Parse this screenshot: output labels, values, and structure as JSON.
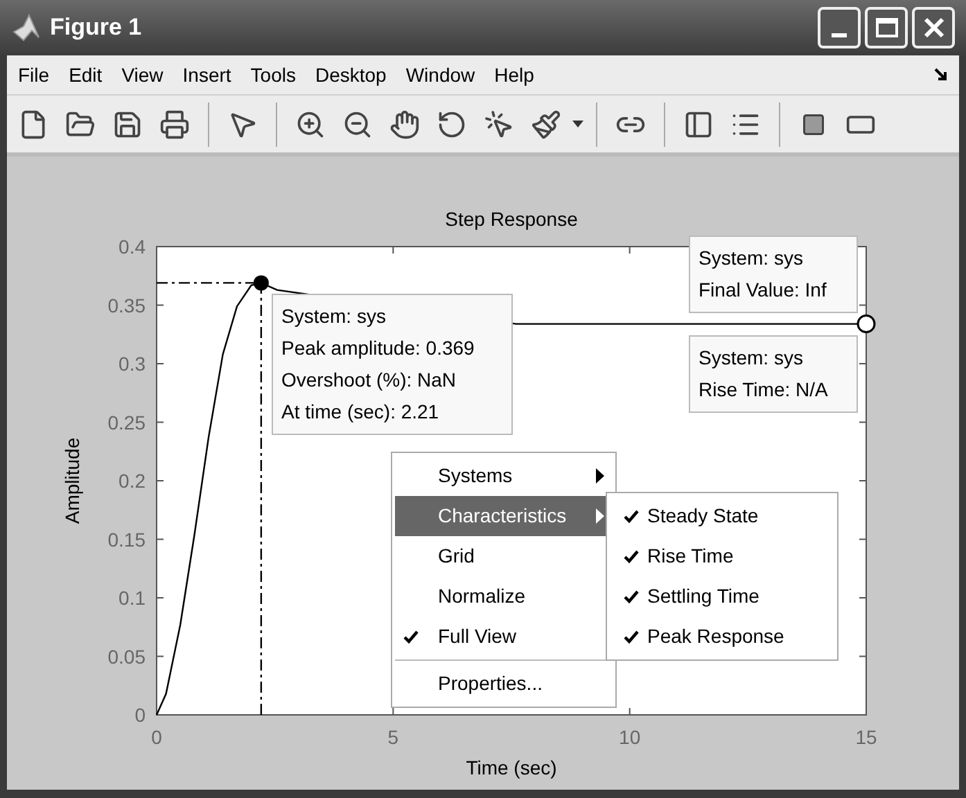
{
  "window": {
    "title": "Figure 1"
  },
  "menu_bar": {
    "items": [
      "File",
      "Edit",
      "View",
      "Insert",
      "Tools",
      "Desktop",
      "Window",
      "Help"
    ]
  },
  "figure": {
    "chart_data": {
      "type": "line",
      "title": "Step Response",
      "xlabel": "Time (sec)",
      "ylabel": "Amplitude",
      "x": [
        0,
        0.2,
        0.5,
        0.8,
        1.1,
        1.4,
        1.7,
        2.0,
        2.21,
        2.55,
        7.6,
        15
      ],
      "series": [
        {
          "color": "#000000",
          "values": [
            0,
            0.018,
            0.077,
            0.154,
            0.237,
            0.308,
            0.349,
            0.367,
            0.369,
            0.363,
            0.334,
            0.334
          ]
        }
      ],
      "xlim": [
        0,
        15
      ],
      "ylim": [
        0,
        0.4
      ],
      "xticks": [
        0,
        5,
        10,
        15
      ],
      "yticks": [
        0,
        0.05,
        0.1,
        0.15,
        0.2,
        0.25,
        0.3,
        0.35,
        0.4
      ],
      "ref_lines": [
        {
          "axis": "y",
          "value": 0.369
        },
        {
          "axis": "x",
          "value": 2.21
        }
      ]
    },
    "datatips": [
      {
        "lines": [
          "System: sys",
          "Peak amplitude: 0.369",
          "Overshoot (%): NaN",
          "At time (sec): 2.21"
        ]
      },
      {
        "lines": [
          "System: sys",
          "Final Value: Inf"
        ]
      },
      {
        "lines": [
          "System: sys",
          "Rise Time: N/A"
        ]
      }
    ],
    "context_menu": {
      "items": [
        {
          "label": "Systems",
          "kind": "submenu",
          "checked": false,
          "selected": false
        },
        {
          "label": "Characteristics",
          "kind": "submenu",
          "checked": false,
          "selected": true
        },
        {
          "label": "Grid",
          "kind": "item",
          "checked": false,
          "selected": false
        },
        {
          "label": "Normalize",
          "kind": "item",
          "checked": false,
          "selected": false
        },
        {
          "label": "Full View",
          "kind": "item",
          "checked": true,
          "selected": false
        },
        {
          "label": "Properties...",
          "kind": "item",
          "checked": false,
          "selected": false
        }
      ],
      "submenu": [
        {
          "label": "Steady State",
          "checked": true
        },
        {
          "label": "Rise Time",
          "checked": true
        },
        {
          "label": "Settling Time",
          "checked": true
        },
        {
          "label": "Peak Response",
          "checked": true
        }
      ]
    }
  }
}
